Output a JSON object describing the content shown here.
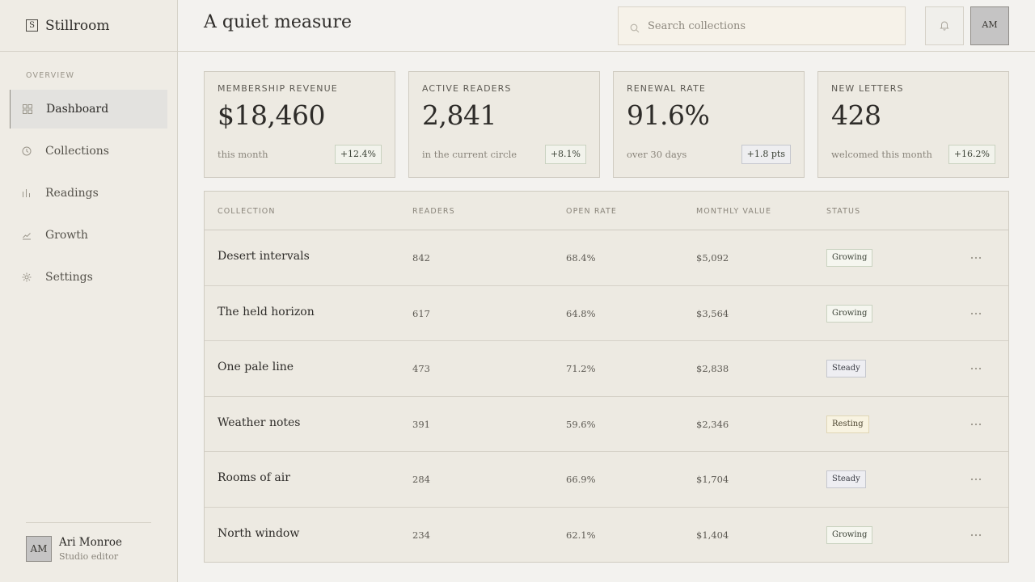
{
  "app": {
    "brand_mark": "S",
    "brand_name": "Stillroom"
  },
  "sidebar": {
    "section_label": "OVERVIEW",
    "items": [
      {
        "label": "Dashboard",
        "icon": "grid-icon",
        "active": true
      },
      {
        "label": "Collections",
        "icon": "clock-icon",
        "active": false
      },
      {
        "label": "Readings",
        "icon": "bar-chart-icon",
        "active": false
      },
      {
        "label": "Growth",
        "icon": "trend-line-icon",
        "active": false
      },
      {
        "label": "Settings",
        "icon": "sun-gear-icon",
        "active": false
      }
    ],
    "user": {
      "initials": "AM",
      "name": "Ari Monroe",
      "role": "Studio editor"
    }
  },
  "header": {
    "title": "A quiet measure",
    "search": {
      "placeholder": "Search collections",
      "value": ""
    },
    "notifications_icon": "bell-icon",
    "avatar_initials": "AM"
  },
  "stats": [
    {
      "label": "MEMBERSHIP REVENUE",
      "value": "$18,460",
      "sub": "this month",
      "delta": "+12.4%"
    },
    {
      "label": "ACTIVE READERS",
      "value": "2,841",
      "sub": "in the current circle",
      "delta": "+8.1%"
    },
    {
      "label": "RENEWAL RATE",
      "value": "91.6%",
      "sub": "over 30 days",
      "delta": "+1.8 pts"
    },
    {
      "label": "NEW LETTERS",
      "value": "428",
      "sub": "welcomed this month",
      "delta": "+16.2%"
    }
  ],
  "table": {
    "columns": [
      "COLLECTION",
      "READERS",
      "OPEN RATE",
      "MONTHLY VALUE",
      "STATUS"
    ],
    "rows": [
      {
        "name": "Desert intervals",
        "readers": "842",
        "open_rate": "68.4%",
        "value": "$5,092",
        "status": "Growing"
      },
      {
        "name": "The held horizon",
        "readers": "617",
        "open_rate": "64.8%",
        "value": "$3,564",
        "status": "Growing"
      },
      {
        "name": "One pale line",
        "readers": "473",
        "open_rate": "71.2%",
        "value": "$2,838",
        "status": "Steady"
      },
      {
        "name": "Weather notes",
        "readers": "391",
        "open_rate": "59.6%",
        "value": "$2,346",
        "status": "Resting"
      },
      {
        "name": "Rooms of air",
        "readers": "284",
        "open_rate": "66.9%",
        "value": "$1,704",
        "status": "Steady"
      },
      {
        "name": "North window",
        "readers": "234",
        "open_rate": "62.1%",
        "value": "$1,404",
        "status": "Growing"
      }
    ],
    "row_action_icon": "more-horizontal-icon"
  }
}
